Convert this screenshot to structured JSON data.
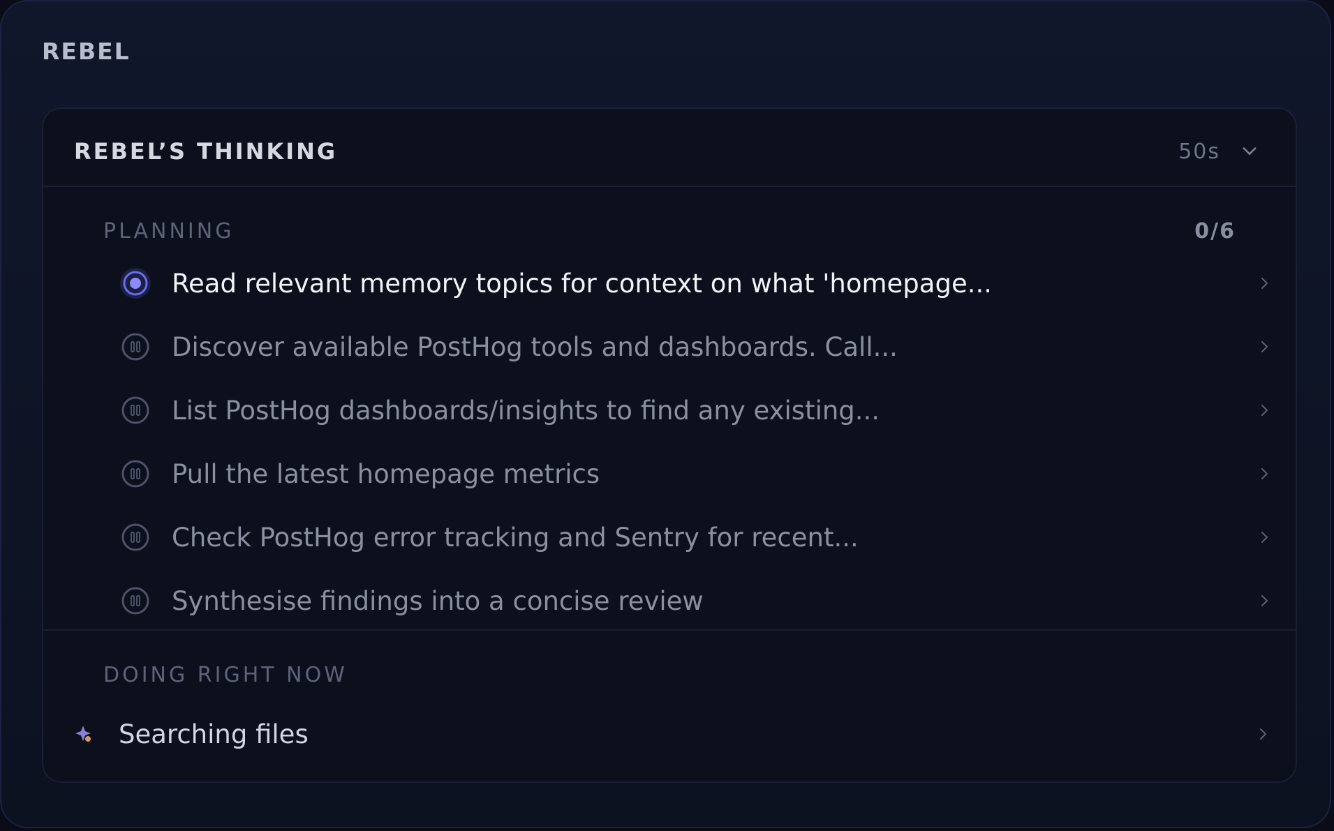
{
  "app": {
    "name": "REBEL"
  },
  "thinking": {
    "title": "REBEL’S THINKING",
    "elapsed": "50s",
    "icons": {
      "collapse": "chevron-down-icon"
    }
  },
  "planning": {
    "label": "PLANNING",
    "progress": "0/6",
    "tasks": [
      {
        "label": "Read relevant memory topics for context on what 'homepage...",
        "status": "in-progress"
      },
      {
        "label": "Discover available PostHog tools and dashboards. Call...",
        "status": "paused"
      },
      {
        "label": "List PostHog dashboards/insights to find any existing...",
        "status": "paused"
      },
      {
        "label": "Pull the latest homepage metrics",
        "status": "paused"
      },
      {
        "label": "Check PostHog error tracking and Sentry for recent...",
        "status": "paused"
      },
      {
        "label": "Synthesise findings into a concise review",
        "status": "paused"
      }
    ]
  },
  "doing_now": {
    "label": "DOING RIGHT NOW",
    "activity": "Searching files",
    "icon": "sparkle-icon"
  },
  "colors": {
    "accent": "#6b6cf2",
    "background": "#0b101c",
    "text_primary": "#f1f3f8",
    "text_muted": "#8b90a0"
  }
}
